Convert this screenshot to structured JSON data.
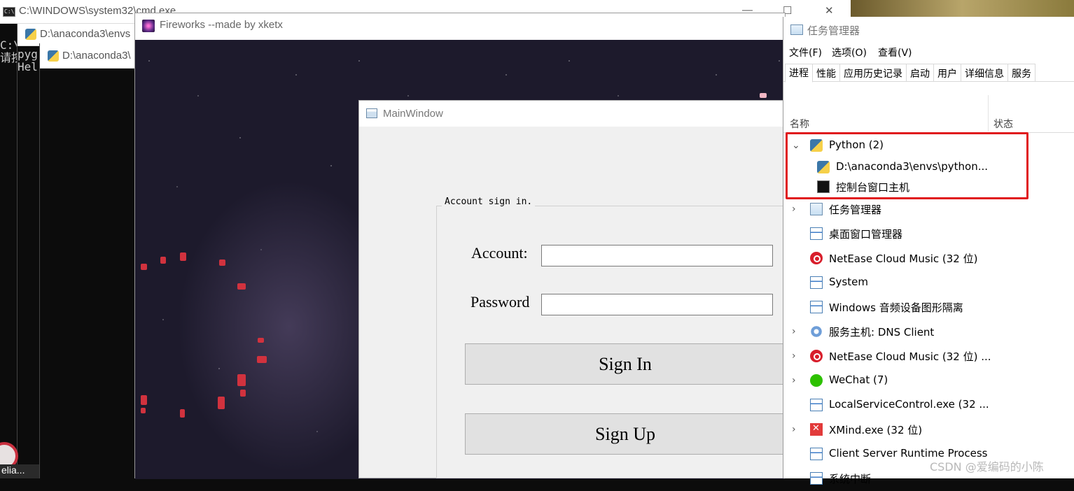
{
  "cmd_window": {
    "title": "C:\\WINDOWS\\system32\\cmd.exe",
    "lines": [
      "C:\\",
      "请按",
      "pyg",
      "Hel"
    ],
    "controls": {
      "minimize": "—",
      "maximize": "☐",
      "close": "✕"
    }
  },
  "anaconda_windows": [
    {
      "title": "D:\\anaconda3\\envs"
    },
    {
      "title": "D:\\anaconda3\\"
    }
  ],
  "taskbar": {
    "bottom_label": "elia..."
  },
  "fireworks_window": {
    "title": "Fireworks --made by xketx"
  },
  "main_window": {
    "title": "MainWindow",
    "group_title": "Account sign in.",
    "account_label": "Account:",
    "password_label": "Password",
    "account_value": "",
    "password_value": "",
    "sign_in_label": "Sign In",
    "sign_up_label": "Sign Up"
  },
  "task_manager": {
    "title": "任务管理器",
    "menu": [
      "文件(F)",
      "选项(O)",
      "查看(V)"
    ],
    "tabs": [
      "进程",
      "性能",
      "应用历史记录",
      "启动",
      "用户",
      "详细信息",
      "服务"
    ],
    "active_tab": "进程",
    "columns": {
      "name": "名称",
      "status": "状态"
    },
    "rows": [
      {
        "label": "Python (2)",
        "icon": "python-icon",
        "expand": "⌄"
      },
      {
        "label": "D:\\anaconda3\\envs\\python...",
        "icon": "python-icon",
        "expand": ""
      },
      {
        "label": "控制台窗口主机",
        "icon": "console-icon",
        "expand": ""
      },
      {
        "label": "任务管理器",
        "icon": "task-manager-icon",
        "expand": "›"
      },
      {
        "label": "桌面窗口管理器",
        "icon": "app-window-icon",
        "expand": ""
      },
      {
        "label": "NetEase Cloud Music (32 位)",
        "icon": "netease-icon",
        "expand": ""
      },
      {
        "label": "System",
        "icon": "app-window-icon",
        "expand": ""
      },
      {
        "label": "Windows 音频设备图形隔离",
        "icon": "app-window-icon",
        "expand": ""
      },
      {
        "label": "服务主机: DNS Client",
        "icon": "gear-icon",
        "expand": "›"
      },
      {
        "label": "NetEase Cloud Music (32 位) ...",
        "icon": "netease-icon",
        "expand": "›"
      },
      {
        "label": "WeChat (7)",
        "icon": "wechat-icon",
        "expand": "›"
      },
      {
        "label": "LocalServiceControl.exe (32 ...",
        "icon": "app-window-icon",
        "expand": ""
      },
      {
        "label": "XMind.exe (32 位)",
        "icon": "xmind-icon",
        "expand": "›"
      },
      {
        "label": "Client Server Runtime Process",
        "icon": "app-window-icon",
        "expand": ""
      },
      {
        "label": "系统中断",
        "icon": "app-window-icon",
        "expand": ""
      }
    ]
  },
  "watermark": "CSDN @爱编码的小陈",
  "colors": {
    "highlight": "#e0191d",
    "spark": "#d1323e"
  }
}
